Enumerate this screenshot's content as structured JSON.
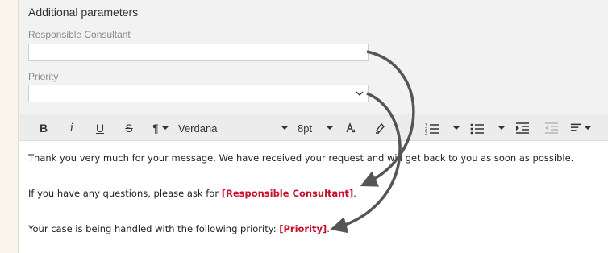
{
  "section": {
    "title": "Additional parameters"
  },
  "fields": {
    "consultant": {
      "label": "Responsible Consultant",
      "value": ""
    },
    "priority": {
      "label": "Priority",
      "value": ""
    }
  },
  "toolbar": {
    "bold": "B",
    "italic": "i",
    "underline": "U",
    "strike": "S",
    "paragraph": "¶",
    "font": "Verdana",
    "size": "8pt"
  },
  "editor": {
    "line1": "Thank you very much for your message. We have received your request and will get back to you as soon as possible.",
    "line2_prefix": "If you have any questions, please ask for ",
    "line2_placeholder": "[Responsible Consultant]",
    "line2_suffix": ".",
    "line3_prefix": "Your case is being handled with the following priority: ",
    "line3_placeholder": "[Priority]",
    "line3_suffix": "."
  },
  "colors": {
    "placeholder": "#c8102e",
    "arrow": "#555555"
  }
}
